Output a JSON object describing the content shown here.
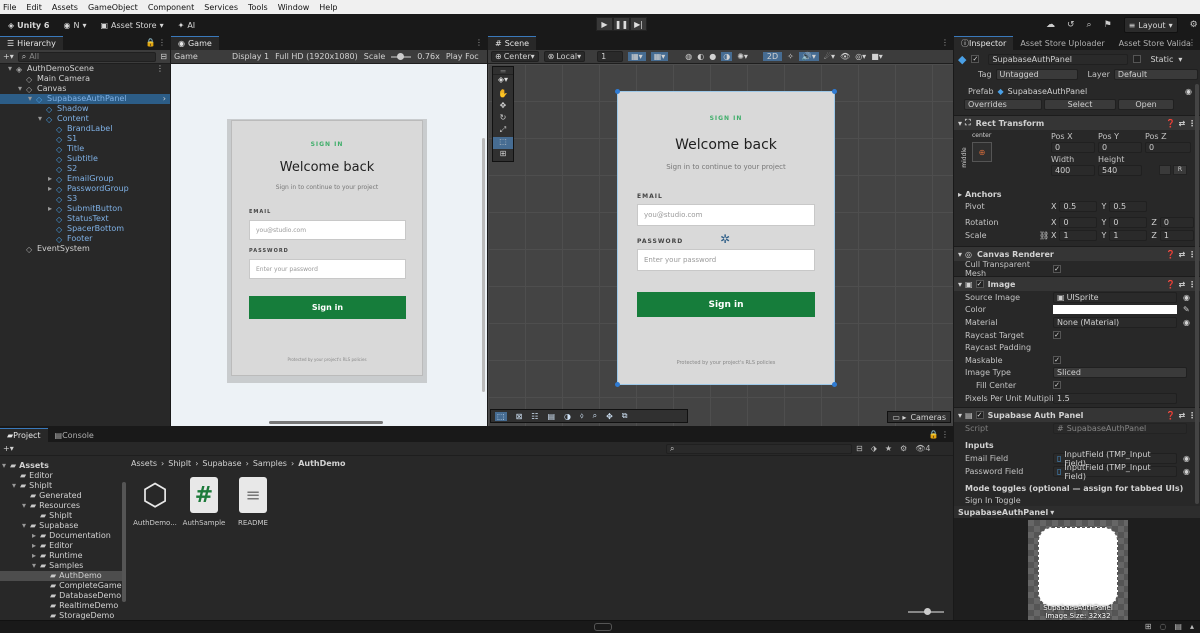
{
  "menubar": [
    "File",
    "Edit",
    "Assets",
    "GameObject",
    "Component",
    "Services",
    "Tools",
    "Window",
    "Help"
  ],
  "toolbar": {
    "unity": "Unity 6",
    "account": "N",
    "asset_store": "Asset Store",
    "ai": "AI",
    "layout": "Layout"
  },
  "hierarchy": {
    "tab": "Hierarchy",
    "search_placeholder": "All",
    "items": [
      {
        "label": "AuthDemoScene",
        "depth": 0,
        "blue": false
      },
      {
        "label": "Main Camera",
        "depth": 1,
        "blue": false
      },
      {
        "label": "Canvas",
        "depth": 1,
        "blue": false
      },
      {
        "label": "SupabaseAuthPanel",
        "depth": 2,
        "blue": true,
        "selected": true
      },
      {
        "label": "Shadow",
        "depth": 3,
        "blue": true
      },
      {
        "label": "Content",
        "depth": 3,
        "blue": true
      },
      {
        "label": "BrandLabel",
        "depth": 4,
        "blue": true
      },
      {
        "label": "S1",
        "depth": 4,
        "blue": true
      },
      {
        "label": "Title",
        "depth": 4,
        "blue": true
      },
      {
        "label": "Subtitle",
        "depth": 4,
        "blue": true
      },
      {
        "label": "S2",
        "depth": 4,
        "blue": true
      },
      {
        "label": "EmailGroup",
        "depth": 4,
        "blue": true
      },
      {
        "label": "PasswordGroup",
        "depth": 4,
        "blue": true
      },
      {
        "label": "S3",
        "depth": 4,
        "blue": true
      },
      {
        "label": "SubmitButton",
        "depth": 4,
        "blue": true
      },
      {
        "label": "StatusText",
        "depth": 4,
        "blue": true
      },
      {
        "label": "SpacerBottom",
        "depth": 4,
        "blue": true
      },
      {
        "label": "Footer",
        "depth": 4,
        "blue": true
      },
      {
        "label": "EventSystem",
        "depth": 1,
        "blue": false
      }
    ]
  },
  "game": {
    "tab": "Game",
    "mode": "Game",
    "display": "Display 1",
    "resolution": "Full HD (1920x1080)",
    "scale_label": "Scale",
    "scale_value": "0.76x",
    "play_focus": "Play Foc"
  },
  "scene": {
    "tab": "Scene",
    "pivot": "Center",
    "space": "Local",
    "snap": "1",
    "mode_2d": "2D",
    "cameras": "Cameras"
  },
  "auth": {
    "brand": "SIGN IN",
    "title": "Welcome back",
    "subtitle": "Sign in to continue to your project",
    "email_label": "EMAIL",
    "email_placeholder": "you@studio.com",
    "password_label": "PASSWORD",
    "password_placeholder": "Enter your password",
    "button": "Sign in",
    "footer": "Protected by your project's RLS policies"
  },
  "inspector": {
    "tabs": [
      "Inspector",
      "Asset Store Uploader",
      "Asset Store Valida"
    ],
    "object_name": "SupabaseAuthPanel",
    "static": "Static",
    "tag_label": "Tag",
    "tag": "Untagged",
    "layer_label": "Layer",
    "layer": "Default",
    "prefab_label": "Prefab",
    "prefab": "SupabaseAuthPanel",
    "overrides": "Overrides",
    "select": "Select",
    "open": "Open",
    "rect_transform": "Rect Transform",
    "anchor_preset": "center",
    "anchor_side": "middle",
    "pos_x_label": "Pos X",
    "pos_y_label": "Pos Y",
    "pos_z_label": "Pos Z",
    "pos_x": "0",
    "pos_y": "0",
    "pos_z": "0",
    "width_label": "Width",
    "height_label": "Height",
    "width": "400",
    "height": "540",
    "anchors": "Anchors",
    "pivot_label": "Pivot",
    "pivot_x": "0.5",
    "pivot_y": "0.5",
    "rotation_label": "Rotation",
    "rot_x": "0",
    "rot_y": "0",
    "rot_z": "0",
    "scale_label": "Scale",
    "scale_x": "1",
    "scale_y": "1",
    "scale_z": "1",
    "canvas_renderer": "Canvas Renderer",
    "cull": "Cull Transparent Mesh",
    "image": "Image",
    "source_image_label": "Source Image",
    "source_image": "UISprite",
    "color_label": "Color",
    "material_label": "Material",
    "material": "None (Material)",
    "raycast_target": "Raycast Target",
    "raycast_padding": "Raycast Padding",
    "maskable": "Maskable",
    "image_type_label": "Image Type",
    "image_type": "Sliced",
    "fill_center": "Fill Center",
    "ppu_label": "Pixels Per Unit Multipli",
    "ppu": "1.5",
    "script_comp": "Supabase Auth Panel",
    "script_label": "Script",
    "script": "SupabaseAuthPanel",
    "inputs": "Inputs",
    "email_field_label": "Email Field",
    "email_field": "InputField (TMP_Input Field)",
    "password_field_label": "Password Field",
    "password_field": "InputField (TMP_Input Field)",
    "mode_toggles": "Mode toggles (optional — assign for tabbed UIs)",
    "sign_in_toggle": "Sign In Toggle",
    "preview_title": "SupabaseAuthPanel",
    "preview_caption1": "SupabaseAuthPanel",
    "preview_caption2": "Image Size: 32x32"
  },
  "project": {
    "tabs": [
      "Project",
      "Console"
    ],
    "breadcrumb": [
      "Assets",
      "ShipIt",
      "Supabase",
      "Samples",
      "AuthDemo"
    ],
    "hidden_count": "4",
    "tree": [
      {
        "label": "Assets",
        "depth": 0
      },
      {
        "label": "Editor",
        "depth": 1
      },
      {
        "label": "ShipIt",
        "depth": 1
      },
      {
        "label": "Generated",
        "depth": 2
      },
      {
        "label": "Resources",
        "depth": 2
      },
      {
        "label": "ShipIt",
        "depth": 3
      },
      {
        "label": "Supabase",
        "depth": 2
      },
      {
        "label": "Documentation",
        "depth": 3
      },
      {
        "label": "Editor",
        "depth": 3
      },
      {
        "label": "Runtime",
        "depth": 3
      },
      {
        "label": "Samples",
        "depth": 3
      },
      {
        "label": "AuthDemo",
        "depth": 4,
        "selected": true
      },
      {
        "label": "CompleteGame",
        "depth": 4
      },
      {
        "label": "DatabaseDemo",
        "depth": 4
      },
      {
        "label": "RealtimeDemo",
        "depth": 4
      },
      {
        "label": "StorageDemo",
        "depth": 4
      }
    ],
    "assets": [
      {
        "label": "AuthDemo...",
        "icon": "unity-scene-icon"
      },
      {
        "label": "AuthSample",
        "icon": "csharp-script-icon"
      },
      {
        "label": "README",
        "icon": "document-icon"
      }
    ]
  },
  "colors": {
    "accent": "#3a79bb",
    "green": "#167d3b",
    "brand_green": "#3fae6a"
  }
}
